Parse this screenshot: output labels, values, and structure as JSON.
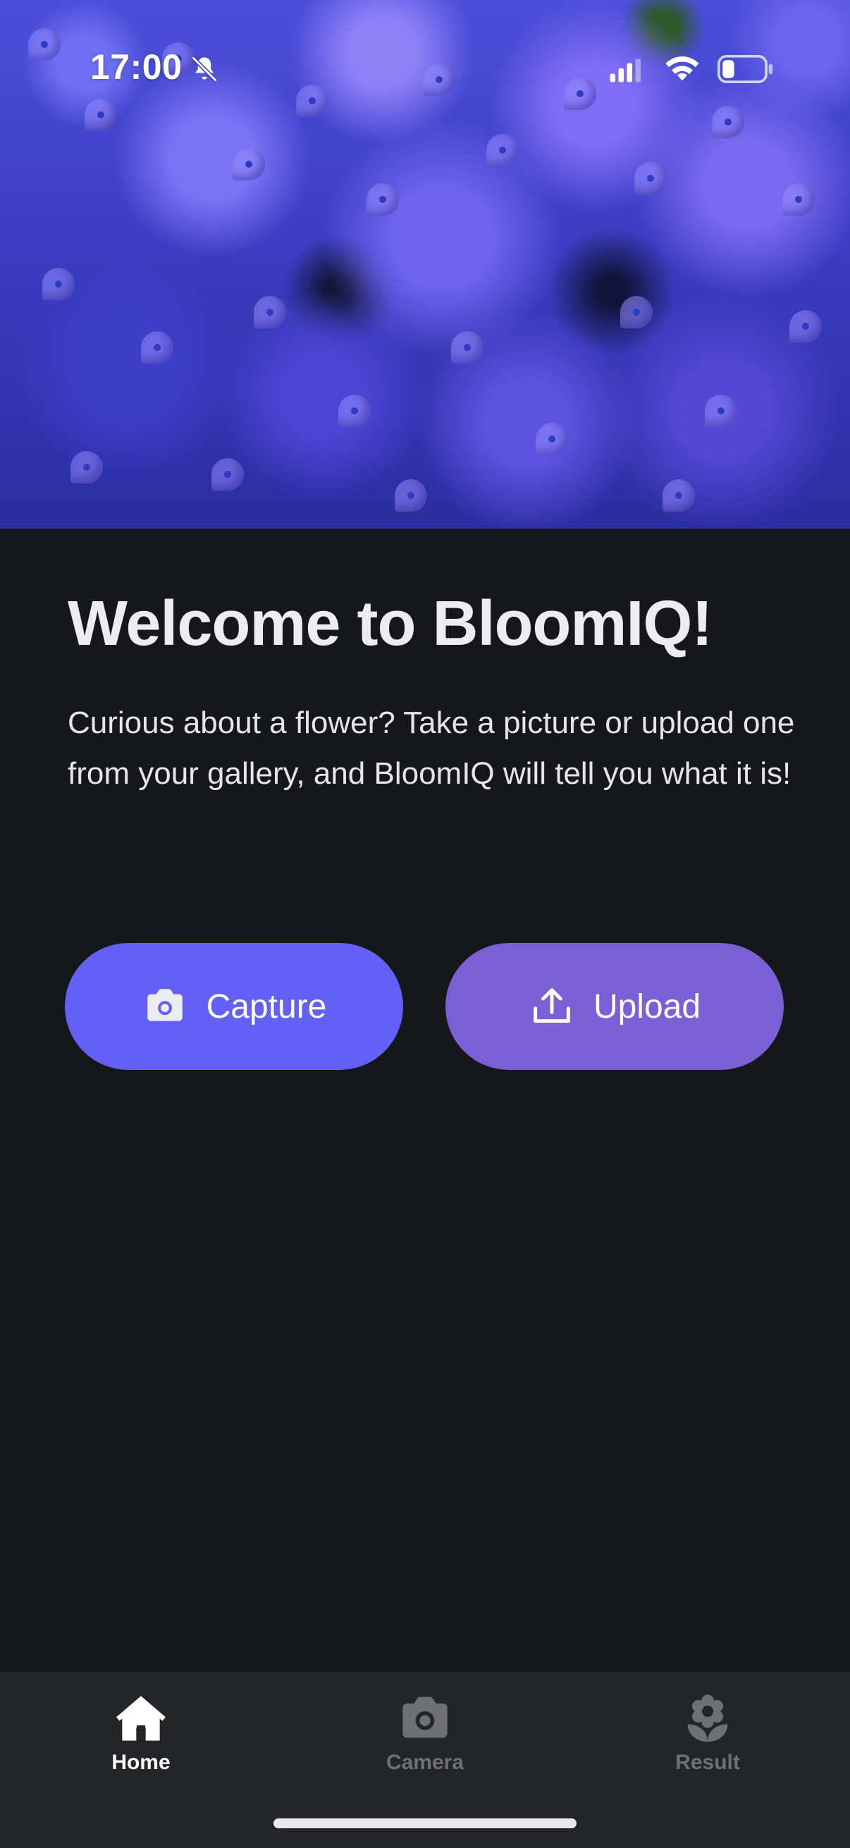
{
  "status_bar": {
    "time": "17:00",
    "icons": [
      "bell-off-icon",
      "signal-icon",
      "wifi-icon",
      "battery-icon"
    ]
  },
  "hero": {
    "image": "purple hydrangea flowers"
  },
  "main": {
    "title": "Welcome to BloomIQ!",
    "description": "Curious about a flower? Take a picture or upload one from your gallery, and BloomIQ will tell you what it is!",
    "buttons": {
      "capture_label": "Capture",
      "upload_label": "Upload"
    }
  },
  "nav": {
    "items": [
      {
        "label": "Home",
        "icon": "home-icon",
        "active": true
      },
      {
        "label": "Camera",
        "icon": "camera-icon",
        "active": false
      },
      {
        "label": "Result",
        "icon": "flower-icon",
        "active": false
      }
    ]
  },
  "colors": {
    "background": "#161719",
    "capture_button": "#6360f7",
    "upload_button": "#7b5fd6",
    "nav_background": "#242527",
    "nav_active": "#ffffff",
    "nav_inactive": "#6f7075"
  }
}
